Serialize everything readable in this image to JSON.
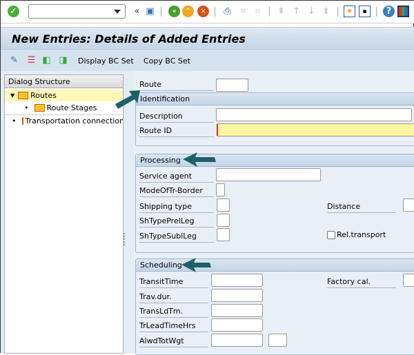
{
  "system_toolbar": {
    "command_field": "",
    "icons": [
      "enter-icon",
      "back-icon",
      "save-icon",
      "back-green-icon",
      "exit-icon",
      "cancel-icon",
      "print-icon",
      "find-icon",
      "find-next-icon",
      "first-page-icon",
      "previous-page-icon",
      "next-page-icon",
      "last-page-icon",
      "new-session-icon",
      "shortcut-icon",
      "help-icon",
      "customize-layout-icon"
    ]
  },
  "title": "New Entries: Details of Added Entries",
  "app_toolbar": {
    "display_bc_set": "Display BC Set",
    "copy_bc_set": "Copy BC Set"
  },
  "dialog_structure": {
    "header": "Dialog Structure",
    "items": [
      {
        "label": "Routes",
        "selected": true
      },
      {
        "label": "Route Stages"
      },
      {
        "label": "Transportation connections"
      }
    ]
  },
  "form": {
    "route_label": "Route",
    "route_value": "",
    "identification": {
      "title": "Identification",
      "description_label": "Description",
      "description_value": "",
      "route_id_label": "Route ID",
      "route_id_value": ""
    },
    "processing": {
      "title": "Processing",
      "service_agent": "Service agent",
      "mode_border": "ModeOfTr-Border",
      "shipping_type": "Shipping type",
      "sh_type_prel": "ShTypePrelLeg",
      "sh_type_subl": "ShTypeSublLeg",
      "distance": "Distance",
      "rel_transport": "Rel.transport",
      "rel_transport_checked": false
    },
    "scheduling": {
      "title": "Scheduling",
      "transit_time": "TransitTime",
      "trav_dur": "Trav.dur.",
      "trans_ld_tm": "TransLdTm.",
      "tr_lead_time": "TrLeadTimeHrs",
      "alwd_tot_wgt": "AlwdTotWgt",
      "factory_cal": "Factory cal."
    }
  },
  "colors": {
    "accent_arrow": "#1f5f66",
    "required_field": "#fff59d",
    "header_bg": "#d6e3ef"
  }
}
